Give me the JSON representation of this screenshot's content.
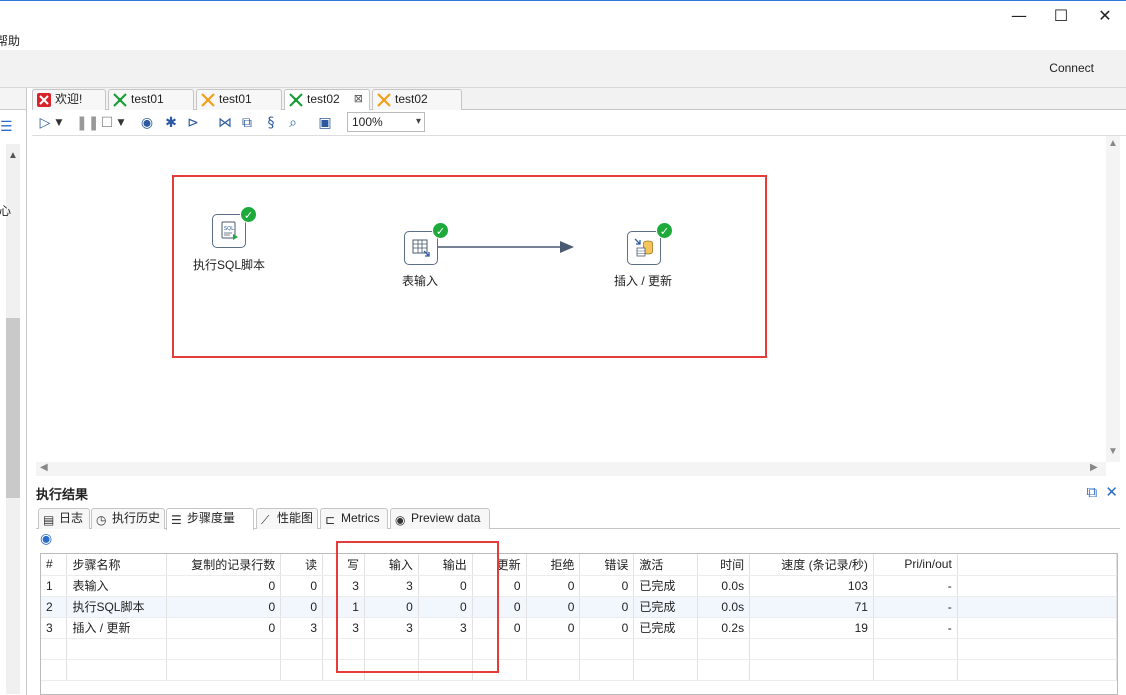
{
  "window": {
    "minimize_glyph": "—",
    "maximize_glyph": "☐",
    "close_glyph": "✕"
  },
  "menu": {
    "partial_item": "帮助"
  },
  "top": {
    "connect_label": "Connect"
  },
  "left_panel": {
    "partial_char": "心"
  },
  "tabs": [
    {
      "label": "欢迎!",
      "icon": "welcome-icon",
      "active": false
    },
    {
      "label": "test01",
      "icon": "job-icon",
      "active": false
    },
    {
      "label": "test01",
      "icon": "transform-icon",
      "active": false
    },
    {
      "label": "test02",
      "icon": "job-icon",
      "active": true,
      "close": "⊠"
    },
    {
      "label": "test02",
      "icon": "transform-icon",
      "active": false
    }
  ],
  "toolbar": {
    "zoom_value": "100%"
  },
  "canvas": {
    "nodes": [
      {
        "label": "执行SQL脚本",
        "icon": "sql-script-icon"
      },
      {
        "label": "表输入",
        "icon": "table-input-icon"
      },
      {
        "label": "插入 / 更新",
        "icon": "insert-update-icon"
      }
    ]
  },
  "results": {
    "title": "执行结果",
    "tabs": [
      {
        "label": "日志",
        "icon": "log-icon"
      },
      {
        "label": "执行历史",
        "icon": "history-icon"
      },
      {
        "label": "步骤度量",
        "icon": "step-metrics-icon",
        "active": true
      },
      {
        "label": "性能图",
        "icon": "performance-graph-icon"
      },
      {
        "label": "Metrics",
        "icon": "metrics-icon"
      },
      {
        "label": "Preview data",
        "icon": "preview-eye-icon"
      }
    ],
    "columns": [
      "#",
      "步骤名称",
      "复制的记录行数",
      "读",
      "写",
      "输入",
      "输出",
      "更新",
      "拒绝",
      "错误",
      "激活",
      "时间",
      "速度 (条记录/秒)",
      "Pri/in/out"
    ],
    "rows": [
      [
        "1",
        "表输入",
        "0",
        "0",
        "3",
        "3",
        "0",
        "0",
        "0",
        "0",
        "已完成",
        "0.0s",
        "103",
        "-"
      ],
      [
        "2",
        "执行SQL脚本",
        "0",
        "0",
        "1",
        "0",
        "0",
        "0",
        "0",
        "0",
        "已完成",
        "0.0s",
        "71",
        "-"
      ],
      [
        "3",
        "插入 / 更新",
        "0",
        "3",
        "3",
        "3",
        "3",
        "0",
        "0",
        "0",
        "已完成",
        "0.2s",
        "19",
        "-"
      ]
    ]
  },
  "colors": {
    "highlight_box": "#e53b3b",
    "success": "#1eaa3b",
    "accent": "#2a6cc8"
  }
}
